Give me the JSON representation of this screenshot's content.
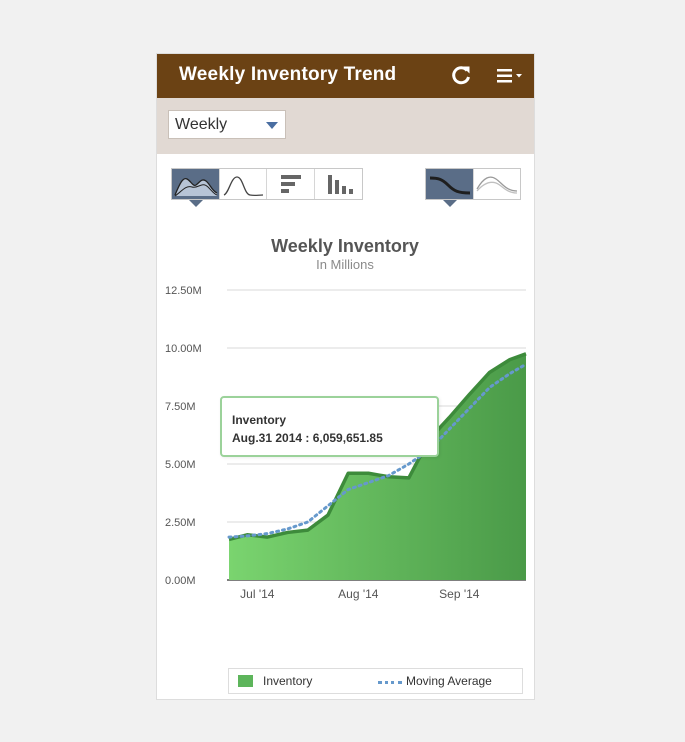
{
  "header": {
    "title": "Weekly Inventory Trend",
    "refresh_icon": "refresh-icon",
    "menu_icon": "hamburger-menu-icon"
  },
  "toolbar": {
    "period_select": {
      "value": "Weekly"
    }
  },
  "chart_type_buttons": [
    "area-chart-icon",
    "line-chart-icon",
    "horizontal-bar-chart-icon",
    "column-chart-icon"
  ],
  "curve_buttons": [
    "smooth-curve-icon",
    "smooth-line-icon"
  ],
  "colors": {
    "header": "#6b4214",
    "toolbar": "#e1d9d3",
    "area_fill_start": "#7ad46f",
    "area_fill_end": "#4a9a48",
    "series_line": "#3d8b3b",
    "moving_average": "#6699cc",
    "button_active": "#5a6d87"
  },
  "tooltip": {
    "series": "Inventory",
    "text": "Aug.31 2014 : 6,059,651.85"
  },
  "chart_data": {
    "type": "area",
    "title": "Weekly Inventory",
    "subtitle": "In Millions",
    "xlabel": "",
    "ylabel": "",
    "ylim": [
      0,
      12.5
    ],
    "yticks": [
      0,
      2.5,
      5,
      7.5,
      10,
      12.5
    ],
    "ytick_labels": [
      "0.00M",
      "2.50M",
      "5.00M",
      "7.50M",
      "10.00M",
      "12.50M"
    ],
    "xlim": [
      -0.5,
      14.3
    ],
    "xticks": [
      {
        "x": 1,
        "label": "Jul '14"
      },
      {
        "x": 6,
        "label": "Aug '14"
      },
      {
        "x": 11,
        "label": "Sep '14"
      }
    ],
    "grid": true,
    "legend_position": "bottom",
    "series": [
      {
        "name": "Inventory",
        "kind": "area",
        "x": [
          -0.4,
          0.5,
          1.5,
          2.5,
          3.5,
          4.5,
          5.5,
          6.5,
          7.5,
          8.5,
          9.5,
          10.5,
          11.5,
          12.5,
          13.5,
          14.3
        ],
        "values": [
          1.75,
          1.95,
          1.85,
          2.05,
          2.15,
          2.8,
          4.6,
          4.6,
          4.45,
          4.4,
          6.06,
          7.0,
          8.0,
          8.95,
          9.5,
          9.75
        ]
      },
      {
        "name": "Moving Average",
        "kind": "dotted-line",
        "x": [
          -0.4,
          0.5,
          1.5,
          2.5,
          3.5,
          4.5,
          5.5,
          6.5,
          7.5,
          8.5,
          9.5,
          10.5,
          11.5,
          12.5,
          13.5,
          14.3
        ],
        "values": [
          1.85,
          1.9,
          2.0,
          2.2,
          2.5,
          3.2,
          3.9,
          4.2,
          4.5,
          5.0,
          5.6,
          6.5,
          7.4,
          8.3,
          8.9,
          9.3
        ]
      }
    ],
    "highlight": {
      "series": "Inventory",
      "x": 9.5,
      "value": 6.06
    }
  },
  "legend": {
    "items": [
      "Inventory",
      "Moving Average"
    ]
  }
}
